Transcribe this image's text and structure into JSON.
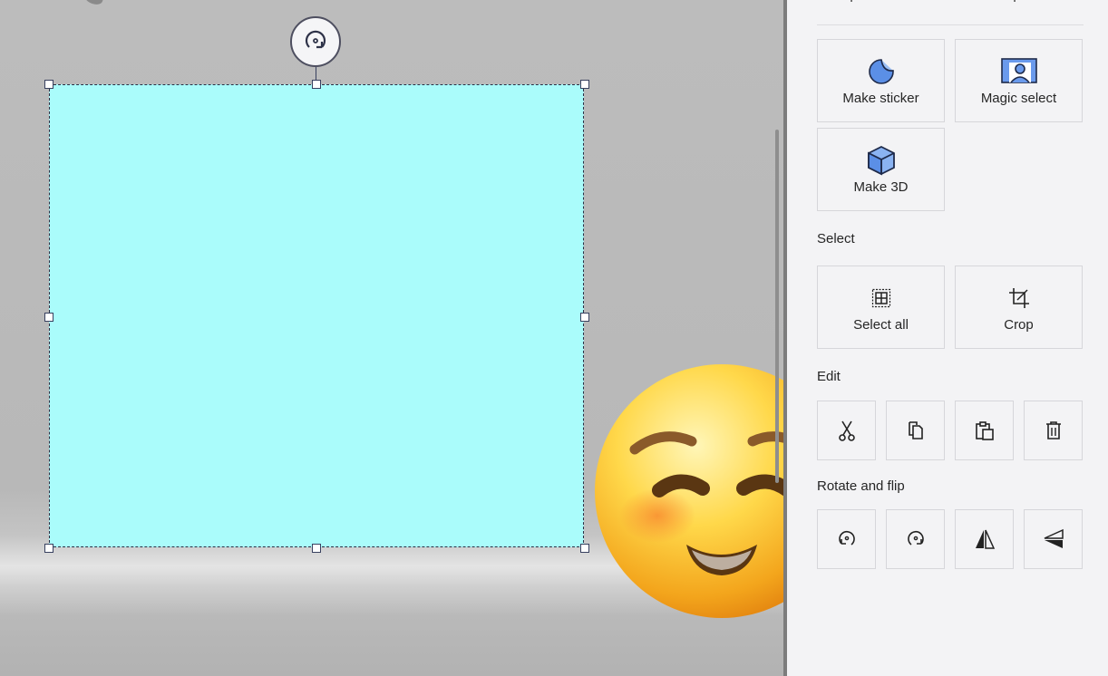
{
  "panel": {
    "top_clipped_labels": [
      "ap",
      "ap"
    ],
    "sections": {
      "select": "Select",
      "edit": "Edit",
      "rotate_flip": "Rotate and flip"
    },
    "magic_tools": [
      {
        "label": "Make sticker",
        "icon": "sticker-icon"
      },
      {
        "label": "Magic select",
        "icon": "magic-select-icon"
      },
      {
        "label": "Make 3D",
        "icon": "cube-icon"
      }
    ],
    "select_tools": [
      {
        "label": "Select all",
        "icon": "select-all-icon"
      },
      {
        "label": "Crop",
        "icon": "crop-icon"
      }
    ],
    "edit_tools": [
      "cut-icon",
      "copy-icon",
      "paste-icon",
      "delete-icon"
    ],
    "rotate_flip_tools": [
      "rotate-left-icon",
      "rotate-right-icon",
      "flip-horizontal-icon",
      "flip-vertical-icon"
    ]
  },
  "canvas": {
    "selection_fill": "#aafcfb",
    "emoji": "smiling-blush-emoji"
  },
  "colors": {
    "panel_bg": "#f3f3f5",
    "accent_blue": "#5b8fe6",
    "icon_dark": "#1e2a4a"
  }
}
